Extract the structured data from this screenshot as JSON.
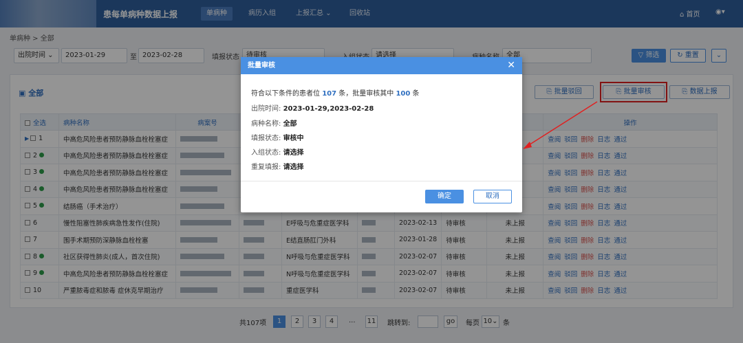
{
  "header": {
    "app_title": "患每单病种数据上报",
    "nav": [
      "单病种",
      "病历入组",
      "上报汇总 ⌄",
      "回收站"
    ],
    "home": "首页",
    "user": "▾"
  },
  "breadcrumb": "单病种 > 全部",
  "filters": {
    "date_type": "出院时间 ⌄",
    "date_from": "2023-01-29",
    "date_to_sep": "至",
    "date_to": "2023-02-28",
    "status_label": "填报状态",
    "status_value": "待审核",
    "group_label": "入组状态",
    "group_value": "请选择",
    "disease_label": "病种名称",
    "disease_value": "全部",
    "filter_btn": "筛选",
    "reset_btn": "重置",
    "more_btn": "⌄"
  },
  "panel": {
    "title": "全部",
    "btn_reject": "批量驳回",
    "btn_approve": "批量审核",
    "btn_report": "数据上报"
  },
  "table": {
    "headers": [
      "全选",
      "病种名称",
      "病案号",
      "",
      "",
      "",
      "",
      "",
      "态",
      "操作"
    ],
    "rows": [
      {
        "no": "1",
        "name": "中高危风险患者预防静脉血栓栓塞症",
        "dept": "",
        "date": "",
        "st1": "",
        "st2": "报"
      },
      {
        "no": "2",
        "name": "中高危风险患者预防静脉血栓栓塞症",
        "dept": "",
        "date": "",
        "st1": "",
        "st2": "报"
      },
      {
        "no": "3",
        "name": "中高危风险患者预防静脉血栓栓塞症",
        "dept": "",
        "date": "",
        "st1": "",
        "st2": "报"
      },
      {
        "no": "4",
        "name": "中高危风险患者预防静脉血栓栓塞症",
        "dept": "",
        "date": "",
        "st1": "",
        "st2": "报"
      },
      {
        "no": "5",
        "name": "结肠癌（手术治疗）",
        "dept": "",
        "date": "",
        "st1": "",
        "st2": "报"
      },
      {
        "no": "6",
        "name": "慢性阻塞性肺疾病急性发作(住院)",
        "dept": "E呼吸与危重症医学科",
        "date": "2023-02-13",
        "st1": "待审核",
        "st2": "未上报"
      },
      {
        "no": "7",
        "name": "围手术期预防深静脉血栓栓塞",
        "dept": "E结直肠肛门外科",
        "date": "2023-01-28",
        "st1": "待审核",
        "st2": "未上报"
      },
      {
        "no": "8",
        "name": "社区获得性肺炎(成人，首次住院)",
        "dept": "N呼吸与危重症医学科",
        "date": "2023-02-07",
        "st1": "待审核",
        "st2": "未上报"
      },
      {
        "no": "9",
        "name": "中高危风险患者预防静脉血栓栓塞症",
        "dept": "N呼吸与危重症医学科",
        "date": "2023-02-07",
        "st1": "待审核",
        "st2": "未上报"
      },
      {
        "no": "10",
        "name": "严重脓毒症和脓毒 症休克早期治疗",
        "dept": "重症医学科",
        "date": "2023-02-07",
        "st1": "待审核",
        "st2": "未上报"
      }
    ],
    "ops": [
      "查阅",
      "驳回",
      "删除",
      "日志",
      "通过"
    ]
  },
  "pager": {
    "total": "共107项",
    "pages": [
      "1",
      "2",
      "3",
      "4",
      "...",
      "11"
    ],
    "jump_label": "跳转到:",
    "go": "go",
    "per_page_label": "每页",
    "per_page_value": "10⌄",
    "unit": "条"
  },
  "modal": {
    "title": "批量审核",
    "close": "✕",
    "summary_pre": "符合以下条件的患者位",
    "summary_count": "107",
    "summary_mid": "条，批量审核其中",
    "summary_batch": "100",
    "summary_post": "条",
    "fields": [
      {
        "label": "出院时间:",
        "value": "2023-01-29,2023-02-28"
      },
      {
        "label": "病种名称:",
        "value": "全部"
      },
      {
        "label": "填报状态:",
        "value": "审核中"
      },
      {
        "label": "入组状态:",
        "value": "请选择"
      },
      {
        "label": "重复填报:",
        "value": "请选择"
      }
    ],
    "ok": "确定",
    "cancel": "取消"
  },
  "colors": {
    "brand": "#2f5f9e",
    "accent": "#4a90e2",
    "highlight": "#e02020",
    "delete": "#d9534f"
  }
}
